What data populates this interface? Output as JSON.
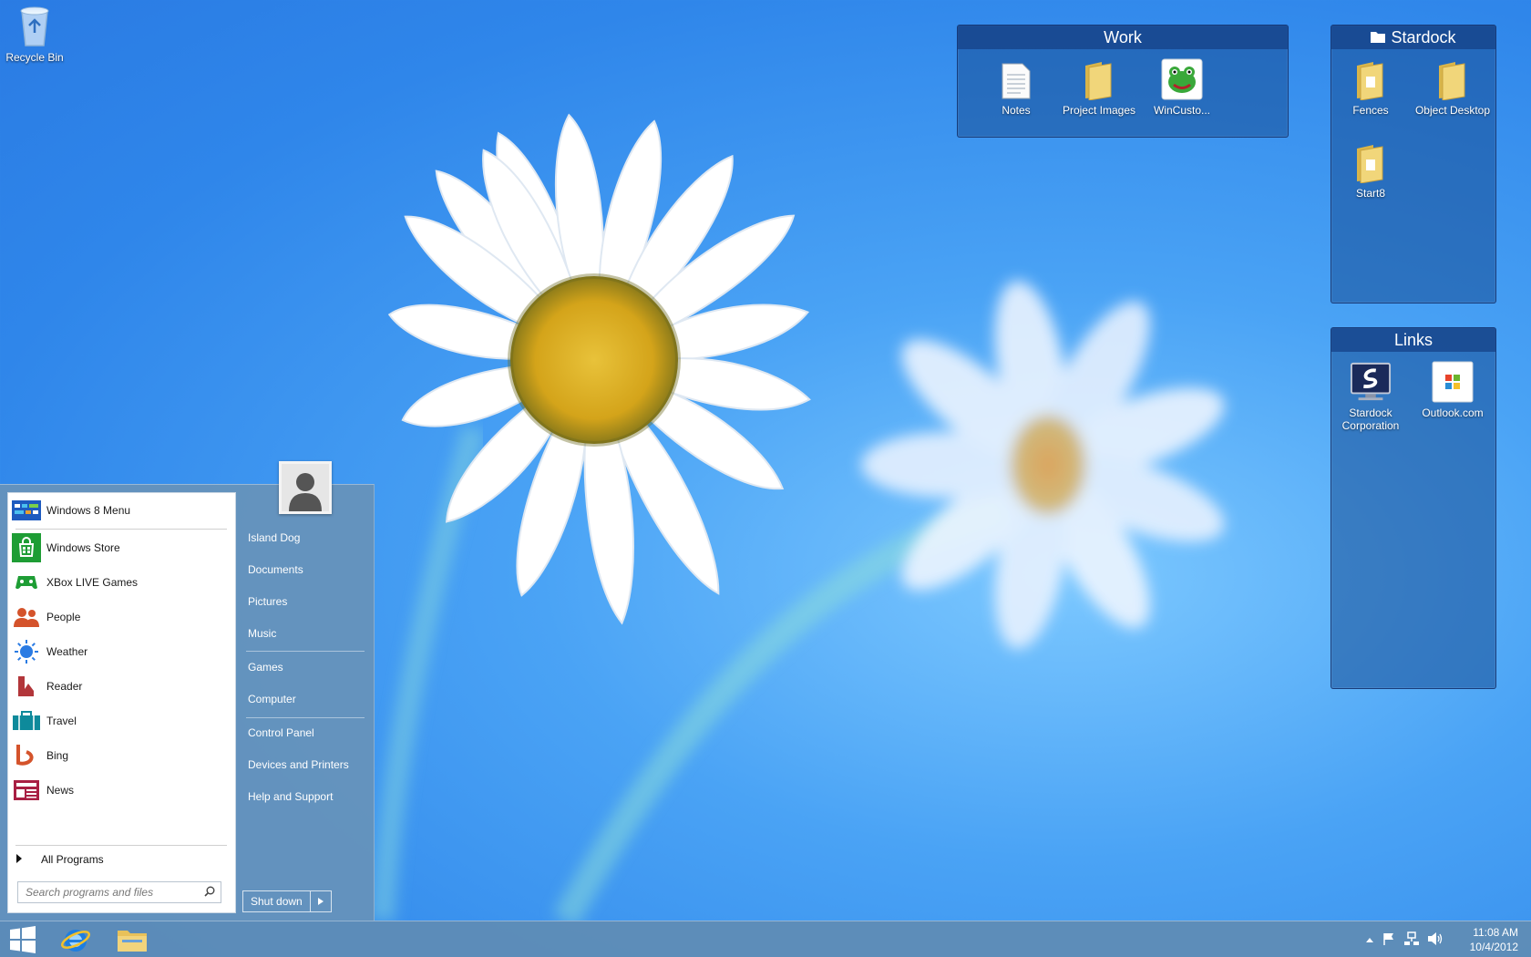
{
  "desktop": {
    "recycle_bin_label": "Recycle Bin"
  },
  "fences": {
    "work": {
      "title": "Work",
      "items": [
        {
          "label": "Notes"
        },
        {
          "label": "Project Images"
        },
        {
          "label": "WinCusto..."
        }
      ]
    },
    "stardock": {
      "title": "Stardock",
      "items": [
        {
          "label": "Fences"
        },
        {
          "label": "Object Desktop"
        },
        {
          "label": "Start8"
        }
      ]
    },
    "links": {
      "title": "Links",
      "items": [
        {
          "label": "Stardock Corporation"
        },
        {
          "label": "Outlook.com"
        }
      ]
    }
  },
  "start_menu": {
    "programs": [
      {
        "label": "Windows 8 Menu",
        "icon": "windows8-menu-icon"
      },
      {
        "label": "Windows Store",
        "icon": "store-icon"
      },
      {
        "label": "XBox LIVE Games",
        "icon": "xbox-icon"
      },
      {
        "label": "People",
        "icon": "people-icon"
      },
      {
        "label": "Weather",
        "icon": "weather-icon"
      },
      {
        "label": "Reader",
        "icon": "reader-icon"
      },
      {
        "label": "Travel",
        "icon": "travel-icon"
      },
      {
        "label": "Bing",
        "icon": "bing-icon"
      },
      {
        "label": "News",
        "icon": "news-icon"
      }
    ],
    "all_programs_label": "All Programs",
    "search_placeholder": "Search programs and files",
    "right_links": [
      {
        "label": "Island Dog"
      },
      {
        "label": "Documents"
      },
      {
        "label": "Pictures"
      },
      {
        "label": "Music"
      },
      {
        "label": "Games"
      },
      {
        "label": "Computer"
      },
      {
        "label": "Control Panel"
      },
      {
        "label": "Devices and Printers"
      },
      {
        "label": "Help and Support"
      }
    ],
    "shutdown_label": "Shut down"
  },
  "taskbar": {
    "time": "11:08 AM",
    "date": "10/4/2012"
  },
  "colors": {
    "fence_bg": "#184e96",
    "start_menu_bg": "#6792ba",
    "taskbar_bg": "#608cb4",
    "store_green": "#1e9d35",
    "people_orange": "#d4532b",
    "reader_red": "#b2363a",
    "travel_teal": "#0e8a9b",
    "news_crimson": "#a81f43"
  }
}
